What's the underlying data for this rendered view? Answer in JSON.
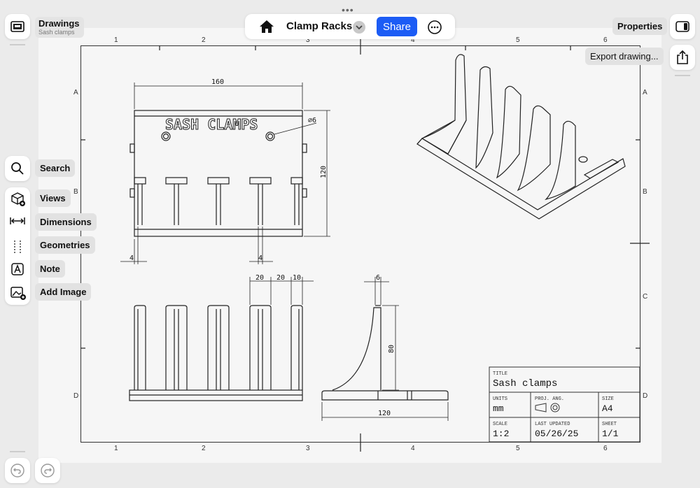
{
  "document": {
    "title": "Clamp Racks",
    "share_label": "Share"
  },
  "sidebar_header": {
    "title": "Drawings",
    "subtitle": "Sash clamps"
  },
  "right_panel": {
    "properties_label": "Properties",
    "export_label": "Export drawing..."
  },
  "tools": {
    "search": "Search",
    "views": "Views",
    "dimensions": "Dimensions",
    "geometries": "Geometries",
    "note": "Note",
    "add_image": "Add Image"
  },
  "drawing": {
    "embossed_text": "SASH CLAMPS",
    "dims": {
      "top_width": "160",
      "height": "120",
      "hole": "⌀6",
      "left_gap": "4",
      "slot_gap": "4",
      "front_d1": "20",
      "front_d2": "20",
      "front_d3": "10",
      "side_top": "6",
      "side_height": "80",
      "side_width": "120"
    },
    "zones": {
      "columns": [
        "1",
        "2",
        "3",
        "4",
        "5",
        "6"
      ],
      "rows": [
        "A",
        "B",
        "C",
        "D"
      ]
    }
  },
  "title_block": {
    "title_label": "TITLE",
    "title_value": "Sash clamps",
    "units_label": "UNITS",
    "units_value": "mm",
    "proj_label": "PROJ. ANG.",
    "size_label": "SIZE",
    "size_value": "A4",
    "scale_label": "SCALE",
    "scale_value": "1:2",
    "updated_label": "LAST UPDATED",
    "updated_value": "05/26/25",
    "sheet_label": "SHEET",
    "sheet_value": "1/1"
  },
  "colors": {
    "accent": "#1c5cf5",
    "line": "#222222",
    "sheet": "#f6f6f6",
    "background": "#ebebeb"
  }
}
